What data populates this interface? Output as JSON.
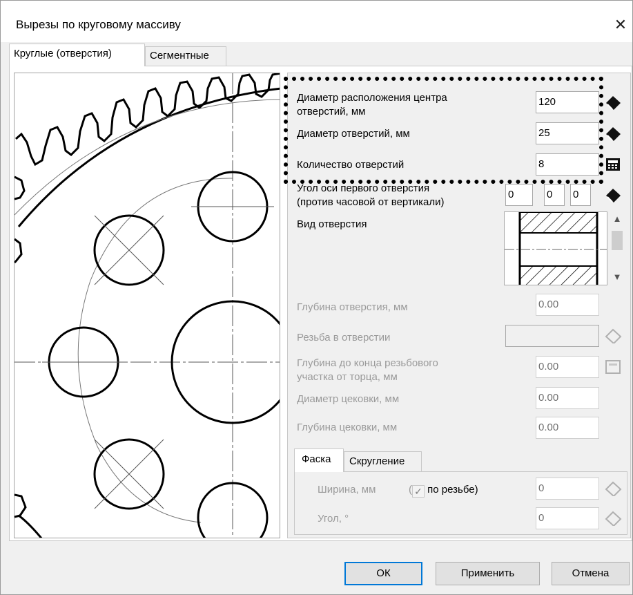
{
  "window": {
    "title": "Вырезы по круговому массиву",
    "close_glyph": "✕"
  },
  "tabs": [
    {
      "label": "Круглые (отверстия)",
      "active": true
    },
    {
      "label": "Сегментные",
      "active": false
    }
  ],
  "params": {
    "center_diameter": {
      "label_line1": "Диаметр расположения центра",
      "label_line2": "отверстий, мм",
      "value": "120",
      "icon": "eraser-icon"
    },
    "hole_diameter": {
      "label": "Диаметр отверстий, мм",
      "value": "25",
      "icon": "eraser-icon"
    },
    "hole_count": {
      "label": "Количество отверстий",
      "value": "8",
      "icon": "calculator-icon"
    },
    "first_hole_angle": {
      "label_line1": "Угол оси первого отверстия",
      "label_line2": "(против часовой от вертикали)",
      "deg": "0",
      "min": "0",
      "sec": "0",
      "icon": "eraser-icon"
    },
    "hole_view": {
      "label": "Вид отверстия"
    },
    "hole_depth": {
      "label": "Глубина отверстия, мм",
      "value": "0.00"
    },
    "thread": {
      "label": "Резьба в отверстии",
      "value": "",
      "icon": "eraser-icon"
    },
    "thread_depth": {
      "label_line1": "Глубина до конца резьбового",
      "label_line2": "участка от торца, мм",
      "value": "0.00",
      "icon": "calculator-icon"
    },
    "counterbore_diameter": {
      "label": "Диаметр цековки, мм",
      "value": "0.00"
    },
    "counterbore_depth": {
      "label": "Глубина цековки, мм",
      "value": "0.00"
    }
  },
  "subtabs": [
    {
      "label": "Фаска",
      "active": true
    },
    {
      "label": "Скругление",
      "active": false
    }
  ],
  "chamfer": {
    "width_label": "Ширина, мм",
    "by_thread_open": "(",
    "by_thread_label": "по резьбе)",
    "by_thread_checked": true,
    "width_value": "0",
    "angle_label": "Угол, °",
    "angle_value": "0"
  },
  "buttons": {
    "ok": "ОК",
    "apply": "Применить",
    "cancel": "Отмена"
  }
}
